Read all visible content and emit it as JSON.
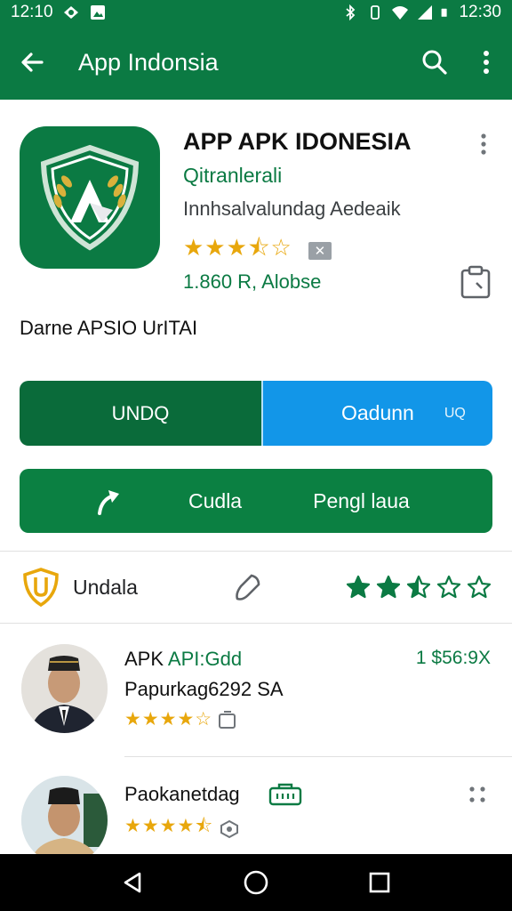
{
  "status_bar": {
    "time_left": "12:10",
    "time_right": "12:30"
  },
  "app_bar": {
    "title": "App Indonsia",
    "back_icon": "arrow-back-icon",
    "search_icon": "search-icon",
    "more_icon": "more-vert-icon"
  },
  "app": {
    "name": "APP APK IDONESIA",
    "developer": "Qitranlerali",
    "category": "Innhsalvalundag Aedeaik",
    "rating_stars": 3.5,
    "tag": "✕",
    "downloads": "1.860 R, Alobse",
    "description": "Darne APSIO UrITAI"
  },
  "buttons": {
    "install_label": "UNDQ",
    "open_label": "Oadunn",
    "open_size": "UQ",
    "guide_label": "Cudla",
    "help_label": "Pengl laua"
  },
  "info_row": {
    "label": "Undala",
    "rate_stars": 2.5
  },
  "reviews": [
    {
      "title_prefix": "APK ",
      "title_green": "API:Gdd",
      "price": "1 $56:9X",
      "subtitle": "Papurkag6292 SA",
      "stars": 4
    },
    {
      "title_prefix": "Paokanetdag",
      "title_green": "",
      "price": "",
      "subtitle": "",
      "stars": 4.5
    }
  ],
  "colors": {
    "primary_green": "#0b7a43",
    "blue": "#1296e8",
    "star": "#e8a70c"
  }
}
